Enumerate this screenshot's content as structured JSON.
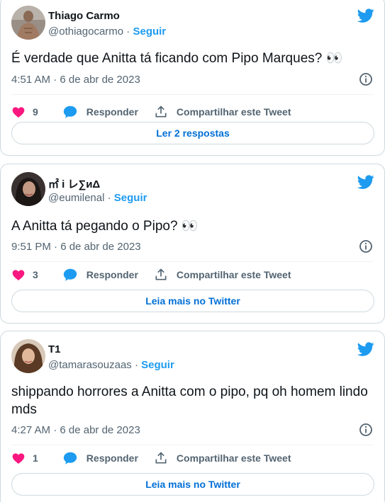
{
  "colors": {
    "twitter_blue": "#1d9bf0",
    "link": "#006fd6",
    "heart": "#f91880",
    "muted": "#536471"
  },
  "tweets": [
    {
      "name": "Thiago Carmo",
      "handle": "@othiagocarmo",
      "sep": "·",
      "follow": "Seguir",
      "text": "É verdade que Anitta tá ficando com Pipo Marques? 👀",
      "time": "4:51 AM · 6 de abr de 2023",
      "likes": "9",
      "reply": "Responder",
      "share": "Compartilhar este Tweet",
      "footer": "Ler 2 respostas"
    },
    {
      "name": "㎡ i レ∑иΔ",
      "handle": "@eumilenal",
      "sep": "·",
      "follow": "Seguir",
      "text": "A Anitta tá pegando o Pipo? 👀",
      "time": "9:51 PM · 6 de abr de 2023",
      "likes": "3",
      "reply": "Responder",
      "share": "Compartilhar este Tweet",
      "footer": "Leia mais no Twitter"
    },
    {
      "name": "T1",
      "handle": "@tamarasouzaas",
      "sep": "·",
      "follow": "Seguir",
      "text": "shippando horrores a Anitta com o pipo, pq oh homem lindo mds",
      "time": "4:27 AM · 6 de abr de 2023",
      "likes": "1",
      "reply": "Responder",
      "share": "Compartilhar este Tweet",
      "footer": "Leia mais no Twitter"
    }
  ]
}
